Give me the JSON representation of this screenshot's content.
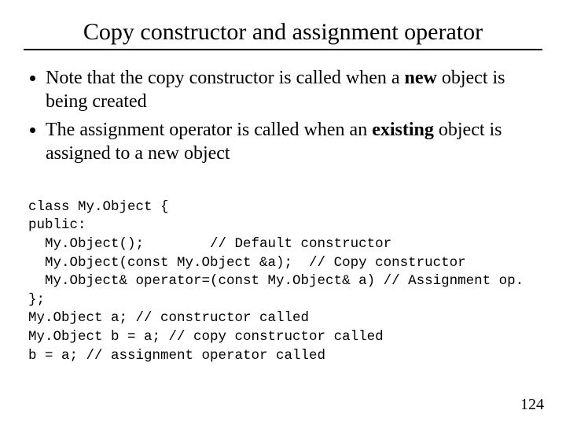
{
  "title": "Copy constructor and assignment operator",
  "bullets": [
    {
      "pre": "Note that the copy constructor is called when a ",
      "bold": "new",
      "post": " object is being created"
    },
    {
      "pre": "The assignment operator is called when an ",
      "bold": "existing",
      "post": " object is assigned to a new object"
    }
  ],
  "code": {
    "l1": "class My.Object {",
    "l2": "public:",
    "l3": "  My.Object();        // Default constructor",
    "l4": "  My.Object(const My.Object &a);  // Copy constructor",
    "l5": "  My.Object& operator=(const My.Object& a) // Assignment op.",
    "l6": "};",
    "l7": "My.Object a; // constructor called",
    "l8": "My.Object b = a; // copy constructor called",
    "l9": "b = a; // assignment operator called"
  },
  "page_number": "124"
}
